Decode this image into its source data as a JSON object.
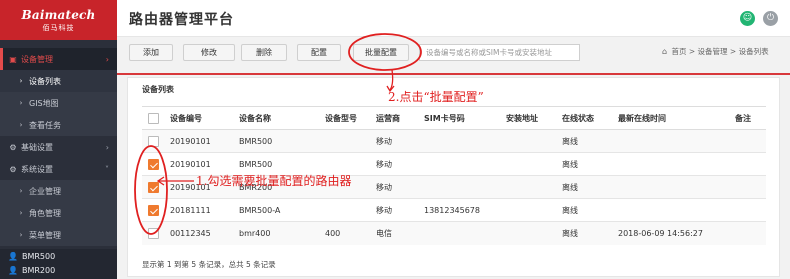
{
  "sidebar": {
    "logo": {
      "brand": "Baimatech",
      "sub": "佰马科技"
    },
    "items": [
      {
        "icon": "monitor-icon",
        "label": "设备管理",
        "glyph": "▣",
        "chev": "›"
      },
      {
        "icon": "chevron-icon",
        "label": "设备列表",
        "glyph": "›"
      },
      {
        "icon": "chevron-icon",
        "label": "GIS地图",
        "glyph": "›"
      },
      {
        "icon": "chevron-icon",
        "label": "查看任务",
        "glyph": "›"
      },
      {
        "icon": "gears-icon",
        "label": "基础设置",
        "glyph": "⚙",
        "chev": "›"
      },
      {
        "icon": "gears-icon",
        "label": "系统设置",
        "glyph": "⚙",
        "chev": "˅"
      },
      {
        "icon": "chevron-icon",
        "label": "企业管理",
        "glyph": "›"
      },
      {
        "icon": "chevron-icon",
        "label": "角色管理",
        "glyph": "›"
      },
      {
        "icon": "chevron-icon",
        "label": "菜单管理",
        "glyph": "›"
      }
    ],
    "devices": [
      {
        "glyph": "👤",
        "label": "BMR500"
      },
      {
        "glyph": "👤",
        "label": "BMR200"
      }
    ]
  },
  "header": {
    "title": "路由器管理平台",
    "user_glyph": "☺",
    "power_glyph": "⏻"
  },
  "toolbar": {
    "add": "添加",
    "edit": "修改",
    "delete": "删除",
    "config": "配置",
    "batch_config": "批量配置",
    "search_placeholder": "设备编号或名称或SIM卡号或安装地址",
    "breadcrumb_home_glyph": "⌂",
    "breadcrumb": "首页 > 设备管理 > 设备列表"
  },
  "panel": {
    "title": "设备列表",
    "columns": [
      "",
      "设备编号",
      "设备名称",
      "设备型号",
      "运营商",
      "SIM卡号码",
      "安装地址",
      "在线状态",
      "最新在线时间",
      "备注"
    ],
    "rows": [
      {
        "checked": false,
        "cells": [
          "20190101",
          "BMR500",
          "",
          "移动",
          "",
          "",
          "离线",
          "",
          ""
        ]
      },
      {
        "checked": true,
        "cells": [
          "20190101",
          "BMR500",
          "",
          "移动",
          "",
          "",
          "离线",
          "",
          ""
        ]
      },
      {
        "checked": true,
        "cells": [
          "20190101",
          "BMR200",
          "",
          "移动",
          "",
          "",
          "离线",
          "",
          ""
        ]
      },
      {
        "checked": true,
        "cells": [
          "20181111",
          "BMR500-A",
          "",
          "移动",
          "13812345678",
          "",
          "离线",
          "",
          ""
        ]
      },
      {
        "checked": false,
        "cells": [
          "00112345",
          "bmr400",
          "400",
          "电信",
          "",
          "",
          "离线",
          "2018-06-09 14:56:27",
          ""
        ]
      }
    ],
    "footer": "显示第 1 到第 5 条记录，总共 5 条记录"
  },
  "annotations": {
    "step2": "2.点击“批量配置”",
    "step1": "1.勾选需要批量配置的路由器"
  },
  "colors": {
    "sidebar_bg": "#2b2f3a",
    "logo_bg": "#c8242a",
    "accent_red": "#d8383b",
    "checkbox_orange": "#ef7a2f",
    "annotation_red": "#e02020"
  }
}
